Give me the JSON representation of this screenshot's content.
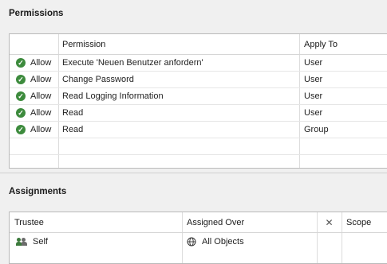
{
  "permissions": {
    "title": "Permissions",
    "columns": [
      "",
      "Permission",
      "Apply To"
    ],
    "rows": [
      {
        "status": "Allow",
        "permission": "Execute 'Neuen Benutzer anfordern'",
        "apply_to": "User"
      },
      {
        "status": "Allow",
        "permission": "Change Password",
        "apply_to": "User"
      },
      {
        "status": "Allow",
        "permission": "Read Logging Information",
        "apply_to": "User"
      },
      {
        "status": "Allow",
        "permission": "Read",
        "apply_to": "User"
      },
      {
        "status": "Allow",
        "permission": "Read",
        "apply_to": "Group"
      }
    ]
  },
  "assignments": {
    "title": "Assignments",
    "columns": {
      "trustee": "Trustee",
      "assigned_over": "Assigned Over",
      "remove": "✕",
      "scope": "Scope"
    },
    "rows": [
      {
        "trustee": "Self",
        "assigned_over": "All Objects",
        "scope": ""
      }
    ]
  },
  "colors": {
    "allow_icon": "#3d8b3d",
    "grid_border": "#b9b9b9",
    "background": "#f0f0f0"
  },
  "icons": {
    "allow": "check-circle-icon",
    "trustee": "users-icon",
    "assigned_over": "globe-icon"
  }
}
